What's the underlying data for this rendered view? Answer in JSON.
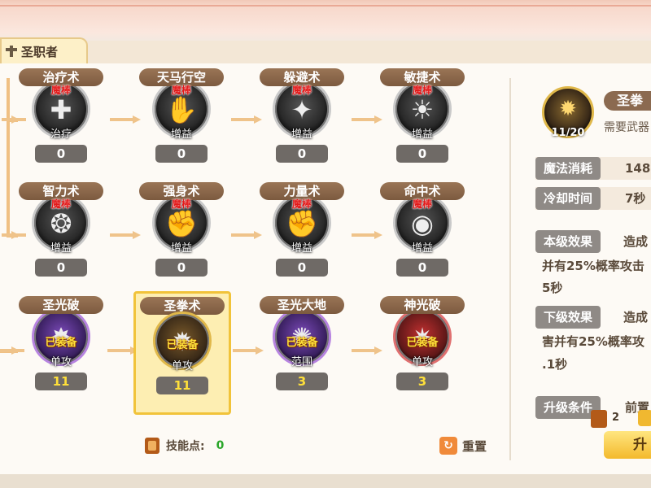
{
  "tab": {
    "label": "圣职者"
  },
  "skills": [
    {
      "name": "治疗术",
      "tag": "魔棒",
      "type": "治疗",
      "level": "0",
      "glyph": "✚"
    },
    {
      "name": "天马行空",
      "tag": "魔棒",
      "type": "增益",
      "level": "0",
      "glyph": "✋"
    },
    {
      "name": "躲避术",
      "tag": "魔棒",
      "type": "增益",
      "level": "0",
      "glyph": "✦"
    },
    {
      "name": "敏捷术",
      "tag": "魔棒",
      "type": "增益",
      "level": "0",
      "glyph": "☀"
    },
    {
      "name": "智力术",
      "tag": "魔棒",
      "type": "增益",
      "level": "0",
      "glyph": "❂"
    },
    {
      "name": "强身术",
      "tag": "魔棒",
      "type": "增益",
      "level": "0",
      "glyph": "✊"
    },
    {
      "name": "力量术",
      "tag": "魔棒",
      "type": "增益",
      "level": "0",
      "glyph": "✊"
    },
    {
      "name": "命中术",
      "tag": "魔棒",
      "type": "增益",
      "level": "0",
      "glyph": "◉"
    },
    {
      "name": "圣光破",
      "tag": "已装备",
      "type": "单攻",
      "level": "11",
      "glyph": "✸"
    },
    {
      "name": "圣拳术",
      "tag": "已装备",
      "type": "单攻",
      "level": "11",
      "glyph": "✹"
    },
    {
      "name": "圣光大地",
      "tag": "已装备",
      "type": "范围",
      "level": "3",
      "glyph": "✺"
    },
    {
      "name": "神光破",
      "tag": "已装备",
      "type": "单攻",
      "level": "3",
      "glyph": "✷"
    }
  ],
  "footer": {
    "points_label": "技能点:",
    "points_value": "0",
    "reset_label": "重置"
  },
  "detail": {
    "name": "圣拳",
    "level": "11/20",
    "requirement": "需要武器",
    "rows": [
      {
        "label": "魔法消耗",
        "value": "148"
      },
      {
        "label": "冷却时间",
        "value": "7秒"
      }
    ],
    "current_label": "本级效果",
    "current_text": [
      "造成",
      "并有25%概率攻击",
      "5秒"
    ],
    "next_label": "下级效果",
    "next_text": [
      "造成",
      "害并有25%概率攻",
      ".1秒"
    ],
    "upgrade_label": "升级条件",
    "upgrade_text": "前置",
    "upgrade_count": "2",
    "upgrade_button": "升"
  },
  "colors": {
    "equipped": "#ffe23a",
    "tag_red": "#e21a1a",
    "points_green": "#2aa62a",
    "selected_border": "#f1c33a"
  }
}
